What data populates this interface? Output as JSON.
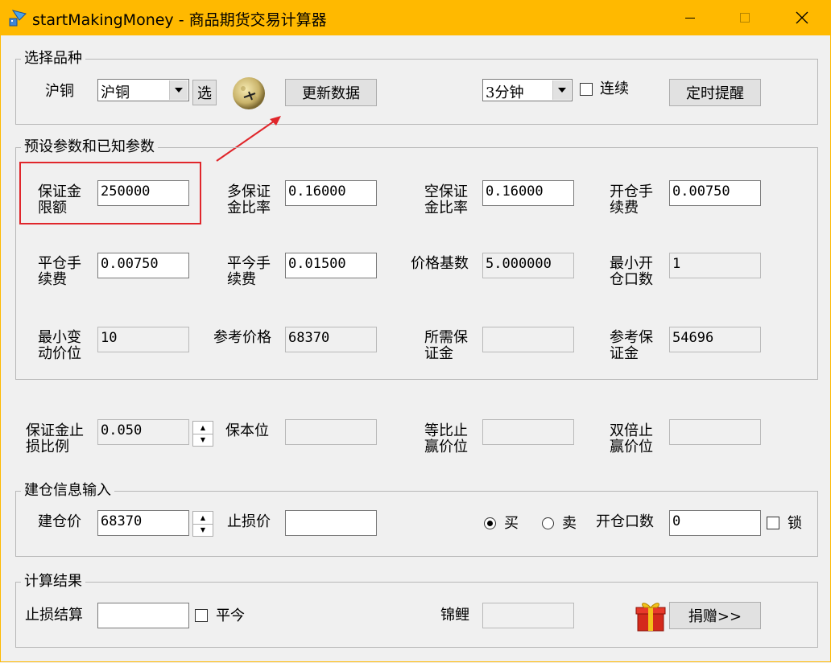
{
  "window": {
    "title": "startMakingMoney - 商品期货交易计算器"
  },
  "select_group": {
    "legend": "选择品种",
    "variety_label": "沪铜",
    "variety_value": "沪铜",
    "select_button": "选",
    "update_button": "更新数据",
    "period_value": "3分钟",
    "continuous_label": "连续",
    "continuous_checked": false,
    "timer_button": "定时提醒"
  },
  "params_group": {
    "legend": "预设参数和已知参数",
    "margin_amount": {
      "label_1": "保证金",
      "label_2": "限额",
      "value": "250000"
    },
    "long_margin_ratio": {
      "label_1": "多保证",
      "label_2": "金比率",
      "value": "0.16000"
    },
    "short_margin_ratio": {
      "label_1": "空保证",
      "label_2": "金比率",
      "value": "0.16000"
    },
    "open_fee": {
      "label_1": "开仓手",
      "label_2": "续费",
      "value": "0.00750"
    },
    "close_fee": {
      "label_1": "平仓手",
      "label_2": "续费",
      "value": "0.00750"
    },
    "close_today_fee": {
      "label_1": "平今手",
      "label_2": "续费",
      "value": "0.01500"
    },
    "price_base": {
      "label": "价格基数",
      "value": "5.000000"
    },
    "min_lots": {
      "label_1": "最小开",
      "label_2": "仓口数",
      "value": "1"
    },
    "min_tick": {
      "label_1": "最小变",
      "label_2": "动价位",
      "value": "10"
    },
    "ref_price": {
      "label": "参考价格",
      "value": "68370"
    },
    "required_margin": {
      "label_1": "所需保",
      "label_2": "证金",
      "value": ""
    },
    "ref_margin": {
      "label_1": "参考保",
      "label_2": "证金",
      "value": "54696"
    }
  },
  "stop_row": {
    "stop_ratio": {
      "label_1": "保证金止",
      "label_2": "损比例",
      "value": "0.050"
    },
    "breakeven": {
      "label": "保本位",
      "value": ""
    },
    "equal_ratio": {
      "label_1": "等比止",
      "label_2": "赢价位",
      "value": ""
    },
    "double_ratio": {
      "label_1": "双倍止",
      "label_2": "赢价位",
      "value": ""
    }
  },
  "position_group": {
    "legend": "建仓信息输入",
    "entry_price": {
      "label": "建仓价",
      "value": "68370"
    },
    "stop_price": {
      "label": "止损价",
      "value": ""
    },
    "buy_label": "买",
    "sell_label": "卖",
    "direction": "买",
    "lots": {
      "label": "开仓口数",
      "value": "0"
    },
    "lock_label": "锁",
    "lock_checked": false
  },
  "result_group": {
    "legend": "计算结果",
    "stop_settle": {
      "label": "止损结算",
      "value": ""
    },
    "close_today_label": "平今",
    "close_today_checked": false,
    "koi": {
      "label": "锦鲤",
      "value": ""
    },
    "donate_button": "捐赠>>"
  },
  "colors": {
    "titlebar": "#ffb900",
    "highlight": "#e0262b"
  }
}
